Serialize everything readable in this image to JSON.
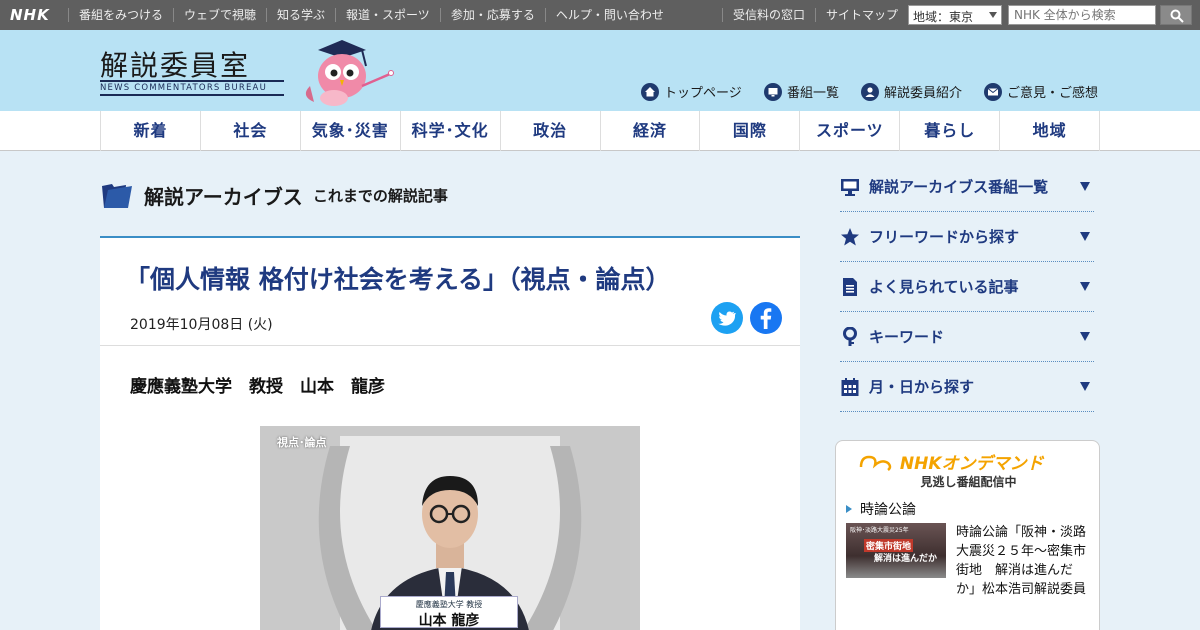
{
  "topbar": {
    "logo": "NHK",
    "links": [
      "番組をみつける",
      "ウェブで視聴",
      "知る学ぶ",
      "報道・スポーツ",
      "参加・応募する",
      "ヘルプ・問い合わせ"
    ],
    "links_right": [
      "受信料の窓口",
      "サイトマップ"
    ],
    "region": "地域：東京",
    "search_placeholder": "NHK 全体から検索"
  },
  "header": {
    "title": "解説委員室",
    "subtitle": "NEWS COMMENTATORS BUREAU",
    "nav": [
      "トップページ",
      "番組一覧",
      "解説委員紹介",
      "ご意見・ご感想"
    ]
  },
  "categories": [
    "新着",
    "社会",
    "気象･災害",
    "科学･文化",
    "政治",
    "経済",
    "国際",
    "スポーツ",
    "暮らし",
    "地域"
  ],
  "archive": {
    "title": "解説アーカイブス",
    "subtitle": "これまでの解説記事"
  },
  "article": {
    "title": "「個人情報 格付け社会を考える」（視点・論点）",
    "date": "2019年10月08日 (火)",
    "author": "慶應義塾大学　教授　山本　龍彦",
    "photo_tag": "視点･論点",
    "nameplate_affiliation": "慶應義塾大学 教授",
    "nameplate_name": "山本 龍彦"
  },
  "sidebar": {
    "items": [
      {
        "label": "解説アーカイブス番組一覧",
        "icon": "monitor-icon"
      },
      {
        "label": "フリーワードから探す",
        "icon": "star-icon"
      },
      {
        "label": "よく見られている記事",
        "icon": "document-icon"
      },
      {
        "label": "キーワード",
        "icon": "key-icon"
      },
      {
        "label": "月・日から探す",
        "icon": "calendar-icon"
      }
    ]
  },
  "ondemand": {
    "logo": "NHKオンデマンド",
    "subtitle": "見逃し番組配信中",
    "program": "時論公論",
    "thumb_small": "阪神･淡路大震災25年",
    "thumb_red": "密集市街地",
    "thumb_caption": "解消は進んだか",
    "description": "時論公論「阪神・淡路大震災２５年～密集市街地　解消は進んだか」松本浩司解説委員"
  },
  "colors": {
    "topbar": "#5f5f5f",
    "header": "#b8e2f4",
    "accent": "#1f3a80",
    "twitter": "#1da1f2",
    "facebook": "#1877f2"
  }
}
